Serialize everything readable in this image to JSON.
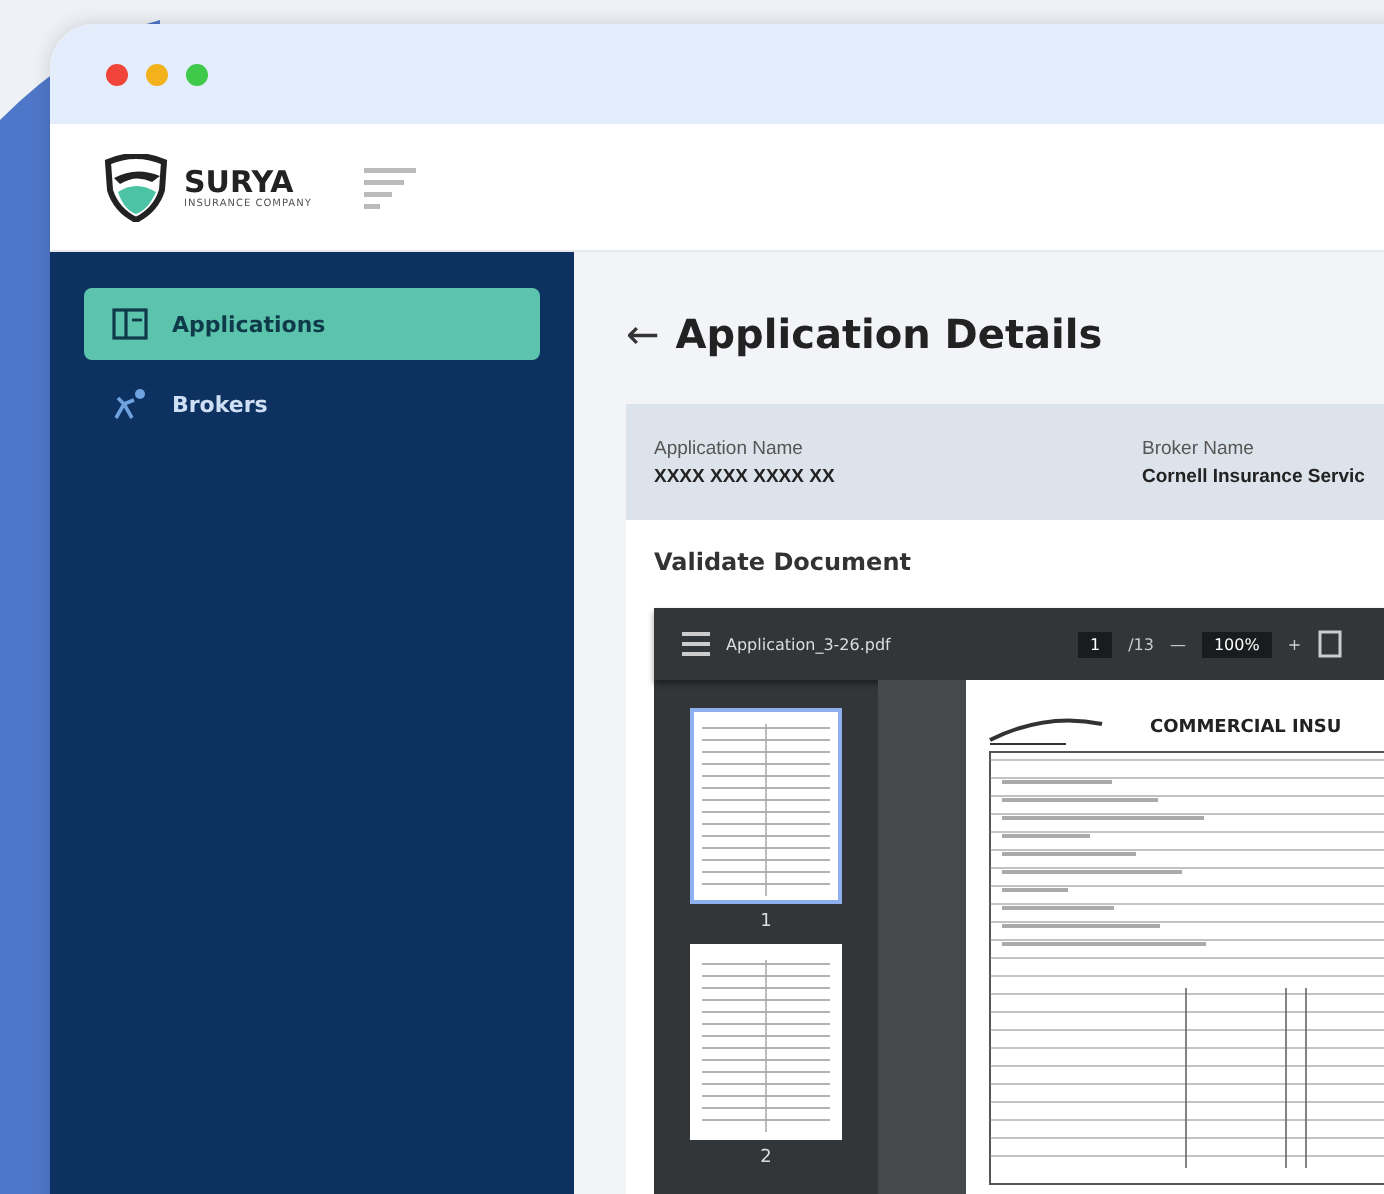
{
  "brand": {
    "name": "SURYA",
    "tagline": "INSURANCE COMPANY"
  },
  "sidebar": {
    "items": [
      {
        "label": "Applications",
        "selected": true
      },
      {
        "label": "Brokers",
        "selected": false
      }
    ]
  },
  "page": {
    "back": "←",
    "title": "Application Details"
  },
  "summary": [
    {
      "label": "Application Name",
      "value": "XXXX XXX XXXX XX"
    },
    {
      "label": "Broker Name",
      "value": "Cornell Insurance Servic"
    }
  ],
  "section": {
    "title": "Validate Document"
  },
  "viewer": {
    "file": "Application_3-26.pdf",
    "page": "1",
    "pages": "/13",
    "zoom_out": "—",
    "zoom": "100%",
    "zoom_in": "+",
    "thumbnails": [
      {
        "label": "1",
        "selected": true
      },
      {
        "label": "2",
        "selected": false
      }
    ],
    "document_heading": "COMMERCIAL INSU"
  }
}
